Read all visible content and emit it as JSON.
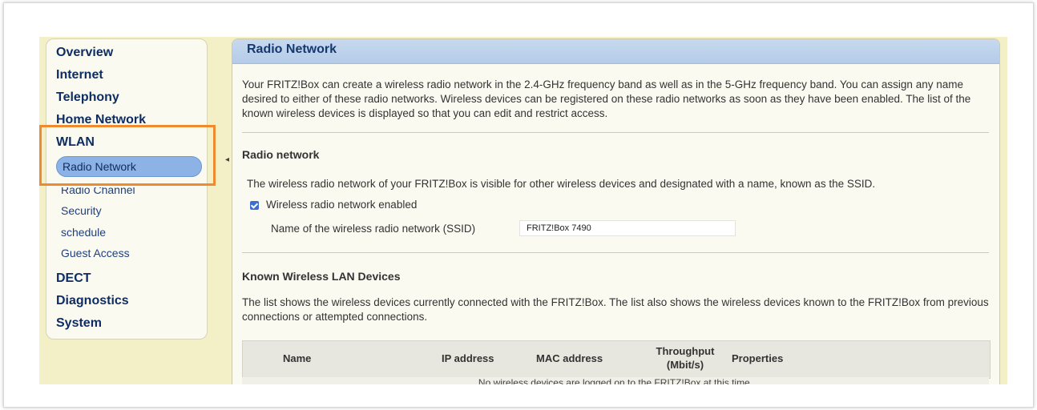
{
  "sidebar": {
    "items": [
      {
        "label": "Overview"
      },
      {
        "label": "Internet"
      },
      {
        "label": "Telephony"
      },
      {
        "label": "Home Network"
      },
      {
        "label": "WLAN"
      }
    ],
    "wlan_sub": [
      {
        "label": "Radio Network"
      },
      {
        "label": "Radio Channel"
      },
      {
        "label": "Security"
      },
      {
        "label": "schedule"
      },
      {
        "label": "Guest Access"
      }
    ],
    "items_after": [
      {
        "label": "DECT"
      },
      {
        "label": "Diagnostics"
      },
      {
        "label": "System"
      }
    ]
  },
  "page": {
    "title": "Radio Network",
    "intro": "Your FRITZ!Box can create a wireless radio network in the 2.4-GHz frequency band as well as in the 5-GHz frequency band. You can assign any name desired to either of these radio networks. Wireless devices can be registered on these radio networks as soon as they have been enabled. The list of the known wireless devices is displayed so that you can edit and restrict access.",
    "radio_section": {
      "title": "Radio network",
      "description": "The wireless radio network of your FRITZ!Box is visible for other wireless devices and designated with a name, known as the SSID.",
      "enabled_label": "Wireless radio network enabled",
      "enabled": true,
      "ssid_label": "Name of the wireless radio network (SSID)",
      "ssid_value": "FRITZ!Box 7490"
    },
    "devices_section": {
      "title": "Known Wireless LAN Devices",
      "description": "The list shows the wireless devices currently connected with the FRITZ!Box. The list also shows the wireless devices known to the FRITZ!Box from previous connections or attempted connections.",
      "columns": {
        "name": "Name",
        "ip": "IP address",
        "mac": "MAC address",
        "throughput_1": "Throughput",
        "throughput_2": "(Mbit/s)",
        "properties": "Properties"
      },
      "empty_message": "No wireless devices are logged on to the FRITZ!Box at this time."
    }
  },
  "colors": {
    "accent_highlight": "#f08a2e",
    "nav_text": "#0e2d63",
    "active_pill": "#8cb2e6",
    "panel_header": "#c7d9ef"
  }
}
